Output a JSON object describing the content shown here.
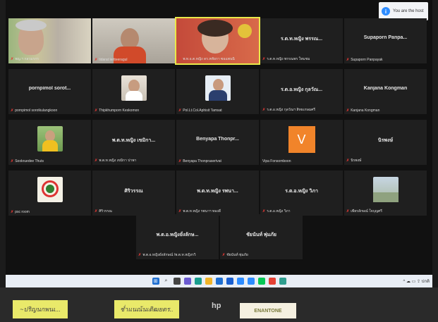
{
  "host_notice": "You are the host",
  "tiles": {
    "t1": {
      "name": "พญ.ฯ กลวมรกร"
    },
    "t2": {
      "name": "tidarat lertteeragul"
    },
    "t3": {
      "name": "พ.ท.อ.ต.หญิง ดร.หทัยกา ซอแพนนิ"
    },
    "t4": {
      "big": "ร.ต.ท.หญิง พรรณ...",
      "name": "ร.ต.ท.หญิง พรรณพร ใหมชม"
    },
    "t5": {
      "big": "Supaporn Panpa...",
      "name": "Supaporn Panpayak"
    },
    "t6": {
      "big": "pornpimol sorot...",
      "name": "pornpimol sorotkulangkoon"
    },
    "t7": {
      "name": "Thipkhumporn Keskomon"
    },
    "t8": {
      "name": "Pol.Lt.Col.Aphisit Tamsat"
    },
    "t9": {
      "big": "ร.ต.อ.หญิง กุลวัณ...",
      "name": "ร.ต.อ.หญิง กุลวัณฯ สิทธเกษมศรี"
    },
    "t10": {
      "big": "Kanjana Kongman",
      "name": "Kanjana Kongman"
    },
    "t11": {
      "name": "Sookruedee Thuts"
    },
    "t12": {
      "big": "พ.ต.ท.หญิง เขมิกา...",
      "name": "พ.ต.ท.หญิง เขมิกา ปาพา"
    },
    "t13": {
      "big": "Benyapa Thonpr...",
      "name": "Benyapa Thonprasertvat"
    },
    "t14": {
      "letter": "V",
      "name": "Vipa Fonsomboon"
    },
    "t15": {
      "big": "นิรพงษ์",
      "name": "นิรพงษ์"
    },
    "t16": {
      "name": "psc room"
    },
    "t17": {
      "big": "ศิริวรรณ",
      "name": "ศิริวรรณ"
    },
    "t18": {
      "big": "พ.ต.ท.หญิง รพนา...",
      "name": "พ.ต.ท.หญิง รพนาฯ ทองดี"
    },
    "t19": {
      "big": "ร.ต.อ.หญิง วิภา",
      "name": "ร.ต.อ.หญิง วิภา"
    },
    "t20": {
      "name": "เพียรลักษณ์ ใจบุญศรี"
    },
    "t21": {
      "big": "พ.ต.อ.หญิงยั่งลักษ...",
      "name": "พ.ต.อ.หญิงยั่งลักษณ์ /พ.ต.ท.หญิงรวิ"
    },
    "t22": {
      "big": "ชัยนันท์ พุ่มภัย",
      "name": "ชัยนันท์ พุ่มภัย"
    }
  },
  "taskbar": {
    "tray": "^ ☁ ▭ ⇪ ปกติ"
  },
  "desk": {
    "note1": "~ปริญนกพนเ...",
    "note2": "ช่ำแนณ้นเติฒยตร..",
    "brand1": "hp",
    "brand2": "ENANTONE"
  },
  "colors": {
    "active_border": "#e9e94a",
    "mic_muted": "#e53935",
    "zoom_blue": "#2d8cff"
  }
}
